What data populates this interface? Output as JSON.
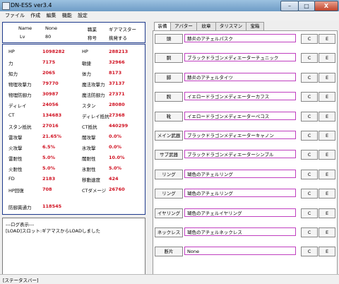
{
  "window": {
    "title": "DN-ESS ver3.4",
    "min": "–",
    "max": "□",
    "close": "X"
  },
  "menu": [
    "ファイル",
    "作成",
    "編集",
    "機能",
    "設定"
  ],
  "profile": {
    "name_label": "Name",
    "name_value": "None",
    "job_label": "職業",
    "job_value": "ギアマスター",
    "lv_label": "Lv",
    "lv_value": "80",
    "title_label": "称号",
    "title_value": "挑発する"
  },
  "stats": [
    {
      "l1": "HP",
      "v1": "1098282",
      "l2": "HP",
      "v2": "288213"
    },
    {
      "l1": "力",
      "v1": "7175",
      "l2": "敏捷",
      "v2": "32966"
    },
    {
      "l1": "知力",
      "v1": "2065",
      "l2": "体力",
      "v2": "8173"
    },
    {
      "l1": "物理攻撃力",
      "v1": "79770",
      "l2": "魔法攻撃力",
      "v2": "37137"
    },
    {
      "l1": "物理防御力",
      "v1": "30987",
      "l2": "魔法防御力",
      "v2": "27371"
    },
    {
      "l1": "ディレイ",
      "v1": "24056",
      "l2": "スタン",
      "v2": "28080"
    },
    {
      "l1": "CT",
      "v1": "134683",
      "l2": "ディレイ抵抗",
      "v2": "27368"
    },
    {
      "l1": "スタン抵抗",
      "v1": "27016",
      "l2": "CT抵抗",
      "v2": "440299"
    },
    {
      "l1": "雷攻撃",
      "v1": "21.65%",
      "l2": "闇攻撃",
      "v2": "0.0%"
    },
    {
      "l1": "火攻撃",
      "v1": "6.5%",
      "l2": "氷攻撃",
      "v2": "0.0%"
    },
    {
      "l1": "雷耐性",
      "v1": "5.0%",
      "l2": "闇耐性",
      "v2": "10.0%"
    },
    {
      "l1": "火耐性",
      "v1": "5.0%",
      "l2": "氷耐性",
      "v2": "5.0%"
    },
    {
      "l1": "FD",
      "v1": "2183",
      "l2": "移動速度",
      "v2": "424"
    },
    {
      "l1": "HP回復",
      "v1": "708",
      "l2": "CTダメージ",
      "v2": "26760"
    },
    {
      "l1": "final_left_label",
      "v1": "",
      "l2": "",
      "v2": ""
    }
  ],
  "pierce": {
    "label": "防御貫通力",
    "value": "118545"
  },
  "tabs": [
    "装備",
    "アバター",
    "紋章",
    "タリスマン",
    "宝箱"
  ],
  "equipment": [
    {
      "slot": "頭",
      "item": "赫炎のアチェルパスク"
    },
    {
      "slot": "胴",
      "item": "ブラックドラゴンメディエーターチュニック"
    },
    {
      "slot": "脚",
      "item": "赫炎のアチェルタイツ"
    },
    {
      "slot": "腕",
      "item": "イエロードラゴンメディエーターカフス"
    },
    {
      "slot": "靴",
      "item": "イエロードラゴンメディエーターペコス"
    },
    {
      "slot": "メイン武器",
      "item": "ブラックドラゴンメディエーターキャノン"
    },
    {
      "slot": "サブ武器",
      "item": "ブラックドラゴンメディエーターシンブル"
    },
    {
      "slot": "リング",
      "item": "瑚色のアチェルリング"
    },
    {
      "slot": "リング",
      "item": "瑚色のアチェルリング"
    },
    {
      "slot": "イヤリング",
      "item": "瑚色のアチェルイヤリング"
    },
    {
      "slot": "ネックレス",
      "item": "瑚色のアチェルネックレス"
    },
    {
      "slot": "断片",
      "item": "None"
    }
  ],
  "buttons": {
    "c": "C",
    "e": "E"
  },
  "log": {
    "header": "---ログ表示---",
    "line1": "[LOAD]スロット:ギアマスからLOADしました"
  },
  "status": "[ステータスバー]"
}
